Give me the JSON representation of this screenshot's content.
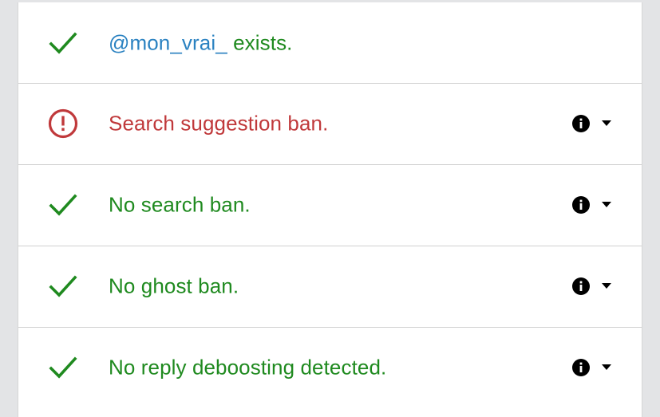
{
  "colors": {
    "success": "#1f8a1f",
    "error": "#c0393b",
    "handle": "#2b82c1",
    "background": "#e3e4e6"
  },
  "results": [
    {
      "status": "success",
      "icon": "check-icon",
      "handle": "@mon_vrai_",
      "text": "exists.",
      "has_info": false
    },
    {
      "status": "error",
      "icon": "error-circle-icon",
      "text": "Search suggestion ban.",
      "has_info": true
    },
    {
      "status": "success",
      "icon": "check-icon",
      "text": "No search ban.",
      "has_info": true
    },
    {
      "status": "success",
      "icon": "check-icon",
      "text": "No ghost ban.",
      "has_info": true
    },
    {
      "status": "success",
      "icon": "check-icon",
      "text": "No reply deboosting detected.",
      "has_info": true
    }
  ]
}
